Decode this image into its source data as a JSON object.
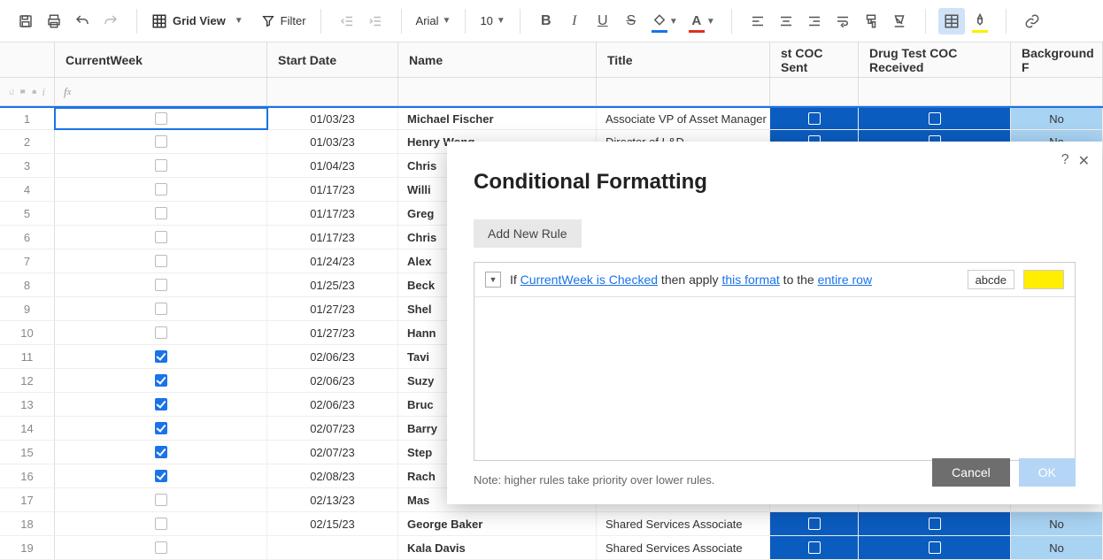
{
  "toolbar": {
    "view_label": "Grid View",
    "filter_label": "Filter",
    "font_name": "Arial",
    "font_size": "10"
  },
  "columns": {
    "cw": "CurrentWeek",
    "sd": "Start Date",
    "name": "Name",
    "title": "Title",
    "coc_sent": "st COC Sent",
    "coc_recv": "Drug Test COC Received",
    "bg": "Background F"
  },
  "rows": [
    {
      "n": "1",
      "cw": false,
      "sd": "01/03/23",
      "name": "Michael Fischer",
      "title": "Associate VP of Asset Manager",
      "bg": "No"
    },
    {
      "n": "2",
      "cw": false,
      "sd": "01/03/23",
      "name": "Henry Wong",
      "title": "Director of L&D",
      "bg": "No"
    },
    {
      "n": "3",
      "cw": false,
      "sd": "01/04/23",
      "name": "Chris",
      "title": "",
      "bg": ""
    },
    {
      "n": "4",
      "cw": false,
      "sd": "01/17/23",
      "name": "Willi",
      "title": "",
      "bg": ""
    },
    {
      "n": "5",
      "cw": false,
      "sd": "01/17/23",
      "name": "Greg",
      "title": "",
      "bg": ""
    },
    {
      "n": "6",
      "cw": false,
      "sd": "01/17/23",
      "name": "Chris",
      "title": "",
      "bg": ""
    },
    {
      "n": "7",
      "cw": false,
      "sd": "01/24/23",
      "name": "Alex",
      "title": "",
      "bg": ""
    },
    {
      "n": "8",
      "cw": false,
      "sd": "01/25/23",
      "name": "Beck",
      "title": "",
      "bg": ""
    },
    {
      "n": "9",
      "cw": false,
      "sd": "01/27/23",
      "name": "Shel",
      "title": "",
      "bg": ""
    },
    {
      "n": "10",
      "cw": false,
      "sd": "01/27/23",
      "name": "Hann",
      "title": "",
      "bg": ""
    },
    {
      "n": "11",
      "cw": true,
      "sd": "02/06/23",
      "name": "Tavi",
      "title": "",
      "bg": ""
    },
    {
      "n": "12",
      "cw": true,
      "sd": "02/06/23",
      "name": "Suzy",
      "title": "",
      "bg": ""
    },
    {
      "n": "13",
      "cw": true,
      "sd": "02/06/23",
      "name": "Bruc",
      "title": "",
      "bg": ""
    },
    {
      "n": "14",
      "cw": true,
      "sd": "02/07/23",
      "name": "Barry",
      "title": "",
      "bg": ""
    },
    {
      "n": "15",
      "cw": true,
      "sd": "02/07/23",
      "name": "Step",
      "title": "",
      "bg": ""
    },
    {
      "n": "16",
      "cw": true,
      "sd": "02/08/23",
      "name": "Rach",
      "title": "",
      "bg": ""
    },
    {
      "n": "17",
      "cw": false,
      "sd": "02/13/23",
      "name": "Mas",
      "title": "",
      "bg": ""
    },
    {
      "n": "18",
      "cw": false,
      "sd": "02/15/23",
      "name": "George Baker",
      "title": "Shared Services Associate",
      "bg": "No"
    },
    {
      "n": "19",
      "cw": false,
      "sd": "",
      "name": "Kala Davis",
      "title": "Shared Services Associate",
      "bg": "No"
    }
  ],
  "dialog": {
    "title": "Conditional Formatting",
    "add_rule": "Add New Rule",
    "rule_if": "If ",
    "rule_condition": "CurrentWeek is Checked",
    "rule_then": " then apply ",
    "rule_format": "this format",
    "rule_to": " to the ",
    "rule_target": "entire row",
    "sample_text": "abcde",
    "note": "Note: higher rules take priority over lower rules.",
    "cancel": "Cancel",
    "ok": "OK",
    "help": "?",
    "close": "✕"
  }
}
